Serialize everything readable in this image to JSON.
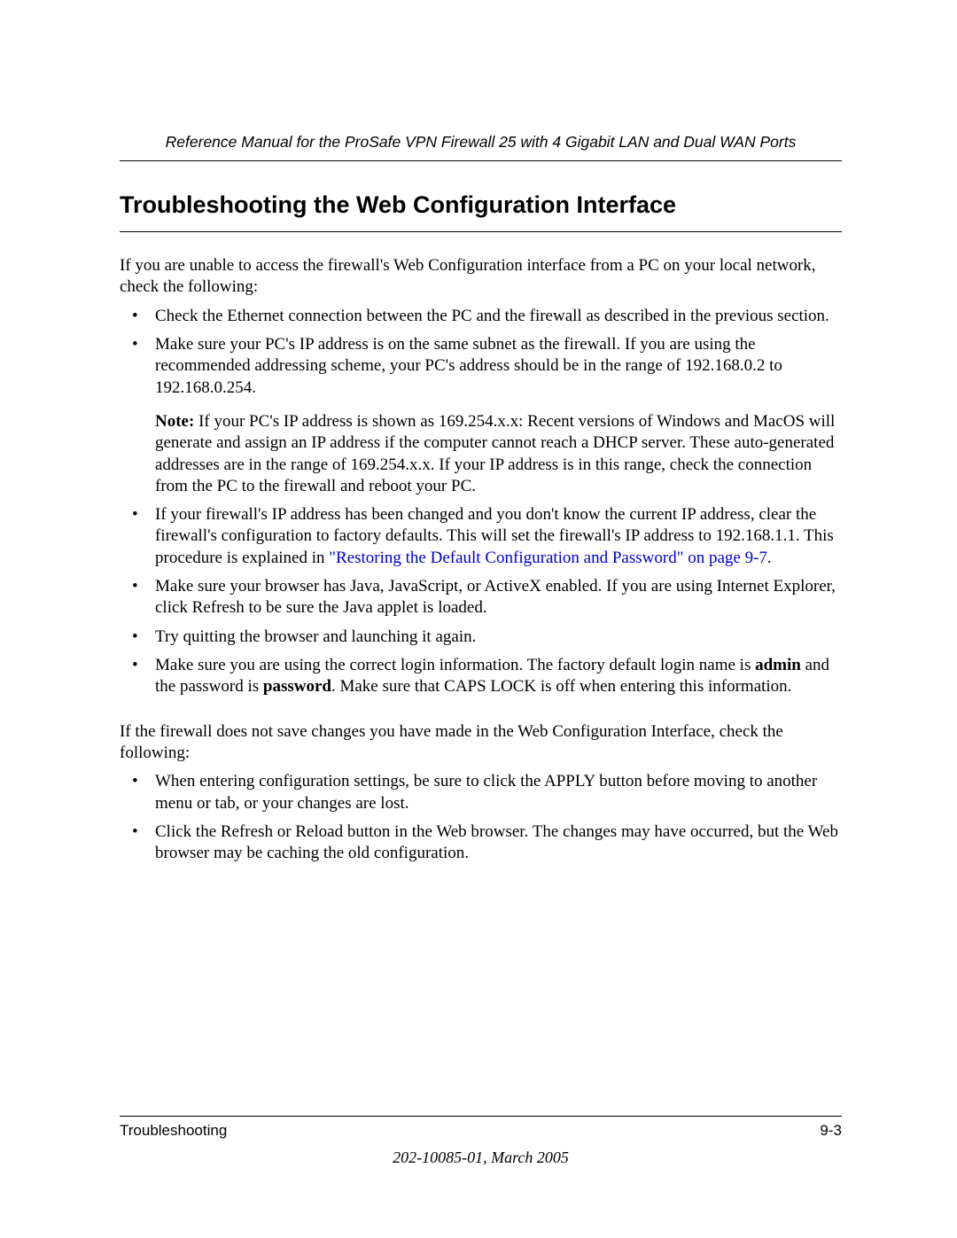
{
  "header": {
    "running_head": "Reference Manual for the ProSafe VPN Firewall 25 with 4 Gigabit LAN and Dual WAN Ports"
  },
  "title": "Troubleshooting the Web Configuration Interface",
  "intro": "If you are unable to access the firewall's Web Configuration interface from a PC on your local network, check the following:",
  "bullets1": {
    "b0": "Check the Ethernet connection between the PC and the firewall as described in the previous section.",
    "b1": "Make sure your PC's IP address is on the same subnet as the firewall. If you are using the recommended addressing scheme, your PC's address should be in the range of 192.168.0.2 to 192.168.0.254.",
    "b1_note_label": "Note:",
    "b1_note_text": " If your PC's IP address is shown as 169.254.x.x: Recent versions of Windows and MacOS will generate and assign an IP address if the computer cannot reach a DHCP server. These auto-generated addresses are in the range of 169.254.x.x. If your IP address is in this range, check the connection from the PC to the firewall and reboot your PC.",
    "b2_pre": "If your firewall's IP address has been changed and you don't know the current IP address, clear the firewall's configuration to factory defaults. This will set the firewall's IP address to 192.168.1.1. This procedure is explained in ",
    "b2_link": "\"Restoring the Default Configuration and Password\" on page 9-7",
    "b2_post": ".",
    "b3": "Make sure your browser has Java, JavaScript, or ActiveX enabled. If you are using Internet Explorer, click Refresh to be sure the Java applet is loaded.",
    "b4": "Try quitting the browser and launching it again.",
    "b5_pre": "Make sure you are using the correct login information. The factory default login name is ",
    "b5_admin": "admin",
    "b5_mid": " and the password is ",
    "b5_pw": "password",
    "b5_post": ". Make sure that CAPS LOCK is off when entering this information."
  },
  "para2": "If the firewall does not save changes you have made in the Web Configuration Interface, check the following:",
  "bullets2": {
    "c0": "When entering configuration settings, be sure to click the APPLY button before moving to another menu or tab, or your changes are lost.",
    "c1": "Click the Refresh or Reload button in the Web browser. The changes may have occurred, but the Web browser may be caching the old configuration."
  },
  "footer": {
    "chapter": "Troubleshooting",
    "pagenum": "9-3",
    "docid": "202-10085-01, March 2005"
  }
}
